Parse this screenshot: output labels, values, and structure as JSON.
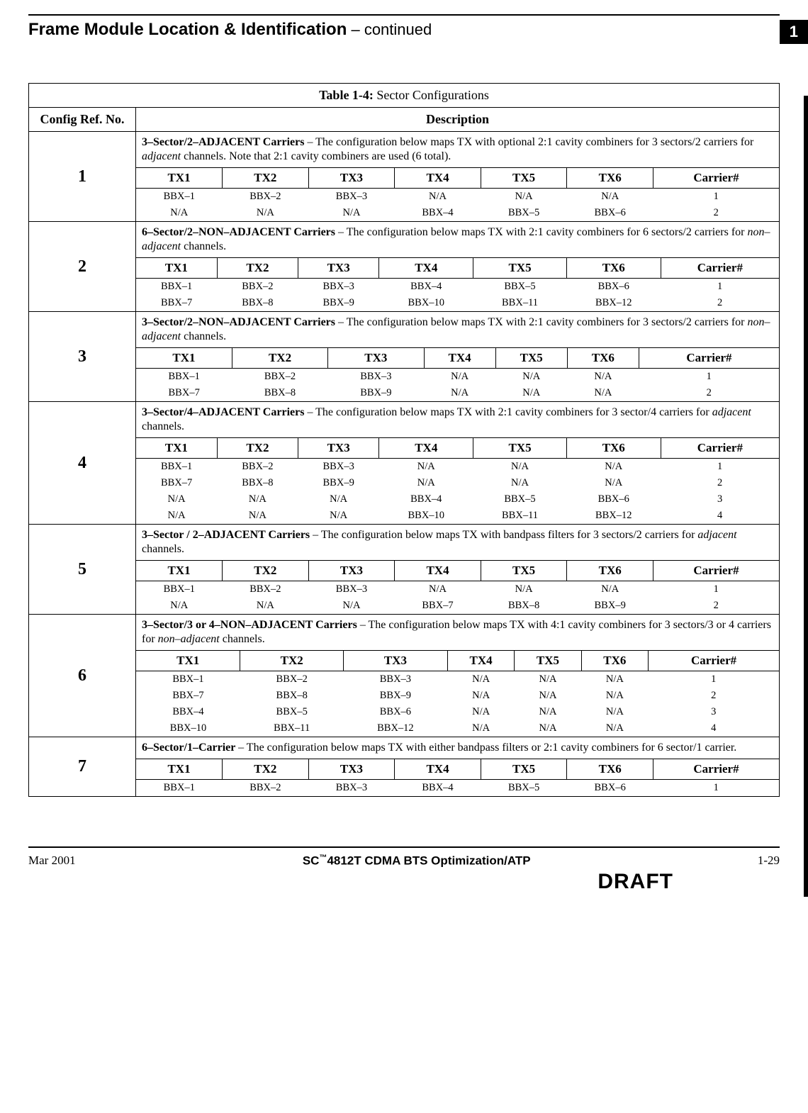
{
  "page": {
    "title_main": "Frame Module Location & Identification",
    "title_cont": " – continued",
    "chapter_box": "1"
  },
  "table": {
    "title_prefix": "Table 1-4:",
    "title_text": " Sector Configurations",
    "col_ref": "Config Ref. No.",
    "col_desc": "Description",
    "tx_headers": [
      "TX1",
      "TX2",
      "TX3",
      "TX4",
      "TX5",
      "TX6",
      "Carrier#"
    ],
    "configs": [
      {
        "ref": "1",
        "desc_bold": "3–Sector/2–ADJACENT Carriers",
        "desc_rest": " – The configuration below maps TX with optional 2:1 cavity combiners for 3 sectors/2 carriers for ",
        "desc_ital": "adjacent",
        "desc_tail": " channels. Note that 2:1 cavity combiners are used (6 total).",
        "rows": [
          [
            "BBX–1",
            "BBX–2",
            "BBX–3",
            "N/A",
            "N/A",
            "N/A",
            "1"
          ],
          [
            "N/A",
            "N/A",
            "N/A",
            "BBX–4",
            "BBX–5",
            "BBX–6",
            "2"
          ]
        ]
      },
      {
        "ref": "2",
        "desc_bold": "6–Sector/2–NON–ADJACENT Carriers",
        "desc_rest": " – The configuration below maps TX with 2:1 cavity combiners for 6 sectors/2 carriers for ",
        "desc_ital": "non–adjacent",
        "desc_tail": " channels.",
        "rows": [
          [
            "BBX–1",
            "BBX–2",
            "BBX–3",
            "BBX–4",
            "BBX–5",
            "BBX–6",
            "1"
          ],
          [
            "BBX–7",
            "BBX–8",
            "BBX–9",
            "BBX–10",
            "BBX–11",
            "BBX–12",
            "2"
          ]
        ]
      },
      {
        "ref": "3",
        "desc_bold": "3–Sector/2–NON–ADJACENT Carriers",
        "desc_rest": " – The configuration below maps TX with 2:1 cavity combiners for 3 sectors/2 carriers for ",
        "desc_ital": "non–adjacent",
        "desc_tail": " channels.",
        "rows": [
          [
            "BBX–1",
            "BBX–2",
            "BBX–3",
            "N/A",
            "N/A",
            "N/A",
            "1"
          ],
          [
            "BBX–7",
            "BBX–8",
            "BBX–9",
            "N/A",
            "N/A",
            "N/A",
            "2"
          ]
        ]
      },
      {
        "ref": "4",
        "desc_bold": "3–Sector/4–ADJACENT Carriers",
        "desc_rest": " – The configuration below maps TX with 2:1 cavity combiners for 3 sector/4 carriers for ",
        "desc_ital": "adjacent",
        "desc_tail": " channels.",
        "rows": [
          [
            "BBX–1",
            "BBX–2",
            "BBX–3",
            "N/A",
            "N/A",
            "N/A",
            "1"
          ],
          [
            "BBX–7",
            "BBX–8",
            "BBX–9",
            "N/A",
            "N/A",
            "N/A",
            "2"
          ],
          [
            "N/A",
            "N/A",
            "N/A",
            "BBX–4",
            "BBX–5",
            "BBX–6",
            "3"
          ],
          [
            "N/A",
            "N/A",
            "N/A",
            "BBX–10",
            "BBX–11",
            "BBX–12",
            "4"
          ]
        ]
      },
      {
        "ref": "5",
        "desc_bold": "3–Sector / 2–ADJACENT Carriers",
        "desc_rest": " – The configuration below maps TX with bandpass filters for 3 sectors/2 carriers for ",
        "desc_ital": "adjacent",
        "desc_tail": " channels.",
        "rows": [
          [
            "BBX–1",
            "BBX–2",
            "BBX–3",
            "N/A",
            "N/A",
            "N/A",
            "1"
          ],
          [
            "N/A",
            "N/A",
            "N/A",
            "BBX–7",
            "BBX–8",
            "BBX–9",
            "2"
          ]
        ]
      },
      {
        "ref": "6",
        "desc_bold": "3–Sector/3 or 4–NON–ADJACENT Carriers",
        "desc_rest": " – The configuration below maps TX with 4:1 cavity combiners for 3 sectors/3 or 4 carriers for ",
        "desc_ital": "non–adjacent",
        "desc_tail": " channels.",
        "rows": [
          [
            "BBX–1",
            "BBX–2",
            "BBX–3",
            "N/A",
            "N/A",
            "N/A",
            "1"
          ],
          [
            "BBX–7",
            "BBX–8",
            "BBX–9",
            "N/A",
            "N/A",
            "N/A",
            "2"
          ],
          [
            "BBX–4",
            "BBX–5",
            "BBX–6",
            "N/A",
            "N/A",
            "N/A",
            "3"
          ],
          [
            "BBX–10",
            "BBX–11",
            "BBX–12",
            "N/A",
            "N/A",
            "N/A",
            "4"
          ]
        ]
      },
      {
        "ref": "7",
        "desc_bold": "6–Sector/1–Carrier ",
        "desc_rest": " – The configuration below maps TX with either bandpass filters or 2:1 cavity combiners for 6 sector/1 carrier.",
        "desc_ital": "",
        "desc_tail": "",
        "rows": [
          [
            "BBX–1",
            "BBX–2",
            "BBX–3",
            "BBX–4",
            "BBX–5",
            "BBX–6",
            "1"
          ]
        ]
      }
    ]
  },
  "footer": {
    "left": "Mar 2001",
    "center_pre": "SC",
    "center_tm": "™",
    "center_post": "4812T CDMA BTS Optimization/ATP",
    "right": "1-29",
    "draft": "DRAFT"
  }
}
